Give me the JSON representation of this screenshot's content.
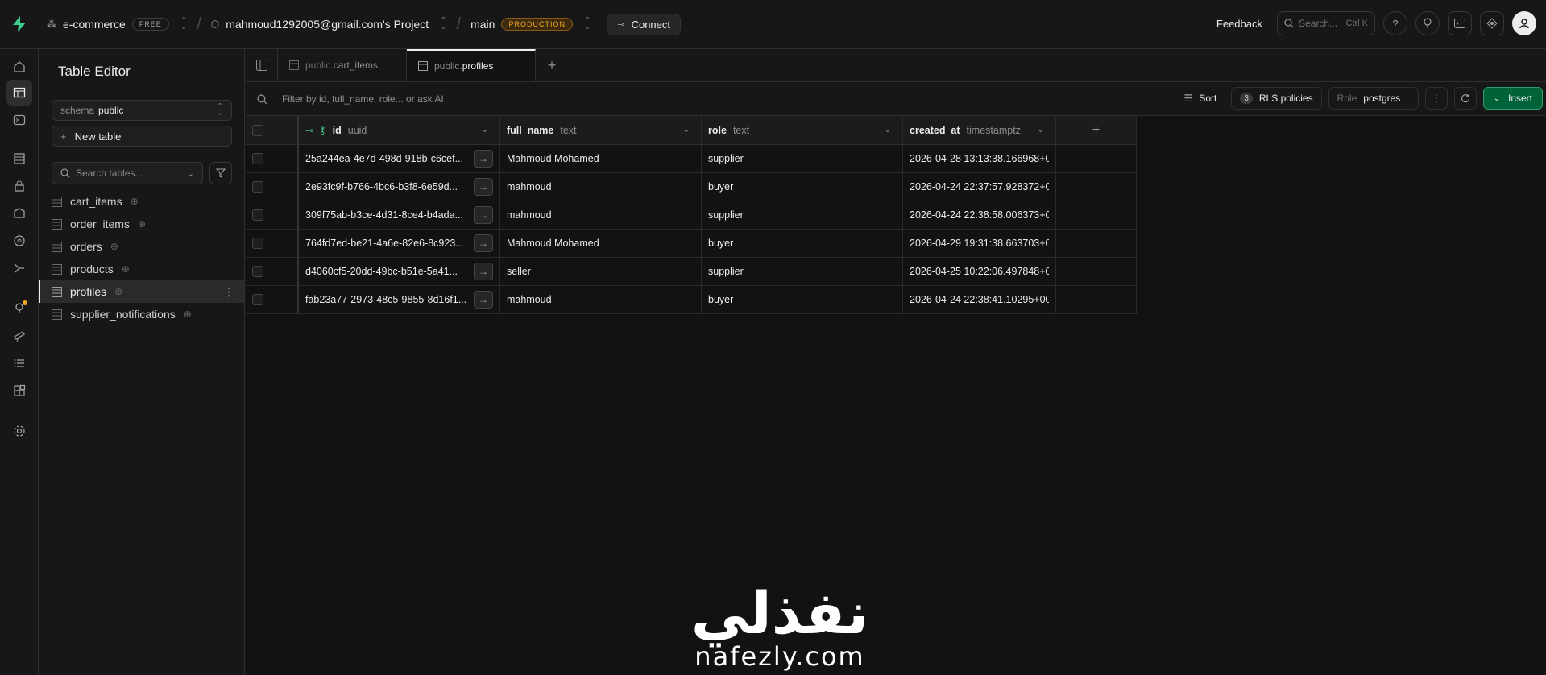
{
  "topbar": {
    "org_name": "e-commerce",
    "org_plan": "FREE",
    "project_name": "mahmoud1292005@gmail.com's Project",
    "branch_name": "main",
    "branch_badge": "PRODUCTION",
    "connect_label": "Connect",
    "feedback_label": "Feedback",
    "search_placeholder": "Search...",
    "search_shortcut": "Ctrl K"
  },
  "sidebar": {
    "title": "Table Editor",
    "schema_label": "schema",
    "schema_value": "public",
    "new_table_label": "New table",
    "search_placeholder": "Search tables...",
    "tables": [
      {
        "name": "cart_items"
      },
      {
        "name": "order_items"
      },
      {
        "name": "orders"
      },
      {
        "name": "products"
      },
      {
        "name": "profiles",
        "active": true
      },
      {
        "name": "supplier_notifications"
      }
    ]
  },
  "tabs": [
    {
      "prefix": "public.",
      "name": "cart_items"
    },
    {
      "prefix": "public.",
      "name": "profiles",
      "active": true
    }
  ],
  "toolbar": {
    "filter_placeholder": "Filter by id, full_name, role... or ask AI",
    "sort_label": "Sort",
    "rls_count": "3",
    "rls_label": "RLS policies",
    "role_label": "Role",
    "role_value": "postgres",
    "insert_label": "Insert"
  },
  "table": {
    "columns": [
      {
        "name": "id",
        "type": "uuid"
      },
      {
        "name": "full_name",
        "type": "text"
      },
      {
        "name": "role",
        "type": "text"
      },
      {
        "name": "created_at",
        "type": "timestamptz"
      }
    ],
    "rows": [
      {
        "id": "25a244ea-4e7d-498d-918b-c6cef...",
        "full_name": "Mahmoud Mohamed",
        "role": "supplier",
        "created_at": "2026-04-28 13:13:38.166968+0"
      },
      {
        "id": "2e93fc9f-b766-4bc6-b3f8-6e59d...",
        "full_name": "mahmoud",
        "role": "buyer",
        "created_at": "2026-04-24 22:37:57.928372+0"
      },
      {
        "id": "309f75ab-b3ce-4d31-8ce4-b4ada...",
        "full_name": "mahmoud",
        "role": "supplier",
        "created_at": "2026-04-24 22:38:58.006373+0"
      },
      {
        "id": "764fd7ed-be21-4a6e-82e6-8c923...",
        "full_name": "Mahmoud Mohamed",
        "role": "buyer",
        "created_at": "2026-04-29 19:31:38.663703+0"
      },
      {
        "id": "d4060cf5-20dd-49bc-b51e-5a41...",
        "full_name": "seller",
        "role": "supplier",
        "created_at": "2026-04-25 10:22:06.497848+0"
      },
      {
        "id": "fab23a77-2973-48c5-9855-8d16f1...",
        "full_name": "mahmoud",
        "role": "buyer",
        "created_at": "2026-04-24 22:38:41.10295+00"
      }
    ]
  },
  "watermark": {
    "arabic": "نفذلي",
    "latin": "nafezly.com"
  },
  "colors": {
    "accent_green": "#3ecf8e",
    "insert_bg": "#006239",
    "production_badge": "#f5a623"
  }
}
